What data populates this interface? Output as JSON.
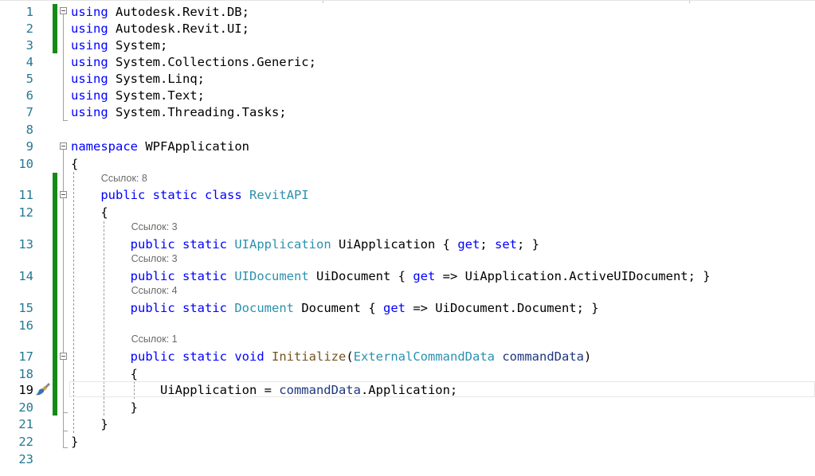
{
  "lines": [
    {
      "n": "1",
      "code": [
        [
          "kw",
          "using"
        ],
        [
          "txt",
          " Autodesk.Revit.DB;"
        ]
      ]
    },
    {
      "n": "2",
      "code": [
        [
          "kw",
          "using"
        ],
        [
          "txt",
          " Autodesk.Revit.UI;"
        ]
      ]
    },
    {
      "n": "3",
      "code": [
        [
          "kw",
          "using"
        ],
        [
          "txt",
          " System;"
        ]
      ]
    },
    {
      "n": "4",
      "code": [
        [
          "kw",
          "using"
        ],
        [
          "txt",
          " System.Collections.Generic;"
        ]
      ]
    },
    {
      "n": "5",
      "code": [
        [
          "kw",
          "using"
        ],
        [
          "txt",
          " System.Linq;"
        ]
      ]
    },
    {
      "n": "6",
      "code": [
        [
          "kw",
          "using"
        ],
        [
          "txt",
          " System.Text;"
        ]
      ]
    },
    {
      "n": "7",
      "code": [
        [
          "kw",
          "using"
        ],
        [
          "txt",
          " System.Threading.Tasks;"
        ]
      ]
    },
    {
      "n": "8",
      "code": []
    },
    {
      "n": "9",
      "code": [
        [
          "kw",
          "namespace"
        ],
        [
          "txt",
          " WPFApplication"
        ]
      ]
    },
    {
      "n": "10",
      "code": [
        [
          "txt",
          "{"
        ]
      ]
    },
    {
      "n": "11",
      "lens": "Ссылок: 8",
      "code": [
        [
          "txt",
          "    "
        ],
        [
          "kw",
          "public"
        ],
        [
          "txt",
          " "
        ],
        [
          "kw",
          "static"
        ],
        [
          "txt",
          " "
        ],
        [
          "kw",
          "class"
        ],
        [
          "txt",
          " "
        ],
        [
          "type",
          "RevitAPI"
        ]
      ]
    },
    {
      "n": "12",
      "code": [
        [
          "txt",
          "    {"
        ]
      ]
    },
    {
      "n": "13",
      "lens": "Ссылок: 3",
      "code": [
        [
          "txt",
          "        "
        ],
        [
          "kw",
          "public"
        ],
        [
          "txt",
          " "
        ],
        [
          "kw",
          "static"
        ],
        [
          "txt",
          " "
        ],
        [
          "type",
          "UIApplication"
        ],
        [
          "txt",
          " UiApplication { "
        ],
        [
          "kw",
          "get"
        ],
        [
          "txt",
          "; "
        ],
        [
          "kw",
          "set"
        ],
        [
          "txt",
          "; }"
        ]
      ]
    },
    {
      "n": "14",
      "lens": "Ссылок: 3",
      "code": [
        [
          "txt",
          "        "
        ],
        [
          "kw",
          "public"
        ],
        [
          "txt",
          " "
        ],
        [
          "kw",
          "static"
        ],
        [
          "txt",
          " "
        ],
        [
          "type",
          "UIDocument"
        ],
        [
          "txt",
          " UiDocument { "
        ],
        [
          "kw",
          "get"
        ],
        [
          "txt",
          " => UiApplication.ActiveUIDocument; }"
        ]
      ]
    },
    {
      "n": "15",
      "lens": "Ссылок: 4",
      "code": [
        [
          "txt",
          "        "
        ],
        [
          "kw",
          "public"
        ],
        [
          "txt",
          " "
        ],
        [
          "kw",
          "static"
        ],
        [
          "txt",
          " "
        ],
        [
          "type",
          "Document"
        ],
        [
          "txt",
          " Document { "
        ],
        [
          "kw",
          "get"
        ],
        [
          "txt",
          " => UiDocument.Document; }"
        ]
      ]
    },
    {
      "n": "16",
      "code": []
    },
    {
      "n": "17",
      "lens": "Ссылок: 1",
      "code": [
        [
          "txt",
          "        "
        ],
        [
          "kw",
          "public"
        ],
        [
          "txt",
          " "
        ],
        [
          "kw",
          "static"
        ],
        [
          "txt",
          " "
        ],
        [
          "kw",
          "void"
        ],
        [
          "txt",
          " "
        ],
        [
          "method",
          "Initialize"
        ],
        [
          "txt",
          "("
        ],
        [
          "type",
          "ExternalCommandData"
        ],
        [
          "txt",
          " "
        ],
        [
          "param",
          "commandData"
        ],
        [
          "txt",
          ")"
        ]
      ]
    },
    {
      "n": "18",
      "code": [
        [
          "txt",
          "        {"
        ]
      ]
    },
    {
      "n": "19",
      "active": true,
      "code": [
        [
          "txt",
          "            UiApplication = "
        ],
        [
          "param",
          "commandData"
        ],
        [
          "txt",
          ".Application;"
        ]
      ]
    },
    {
      "n": "20",
      "code": [
        [
          "txt",
          "        }"
        ]
      ]
    },
    {
      "n": "21",
      "code": [
        [
          "txt",
          "    }"
        ]
      ]
    },
    {
      "n": "22",
      "code": [
        [
          "txt",
          "}"
        ]
      ]
    },
    {
      "n": "23",
      "code": []
    }
  ],
  "colors": {
    "keyword": "#0000ff",
    "type": "#2b91af",
    "method": "#74531f",
    "parameter": "#1f377f",
    "line_number": "#237893",
    "change_bar": "#168a16",
    "code_lens": "#6a6a6a"
  },
  "icons": {
    "quick_actions": "brush-icon",
    "collapse": "collapse-minus-icon"
  }
}
